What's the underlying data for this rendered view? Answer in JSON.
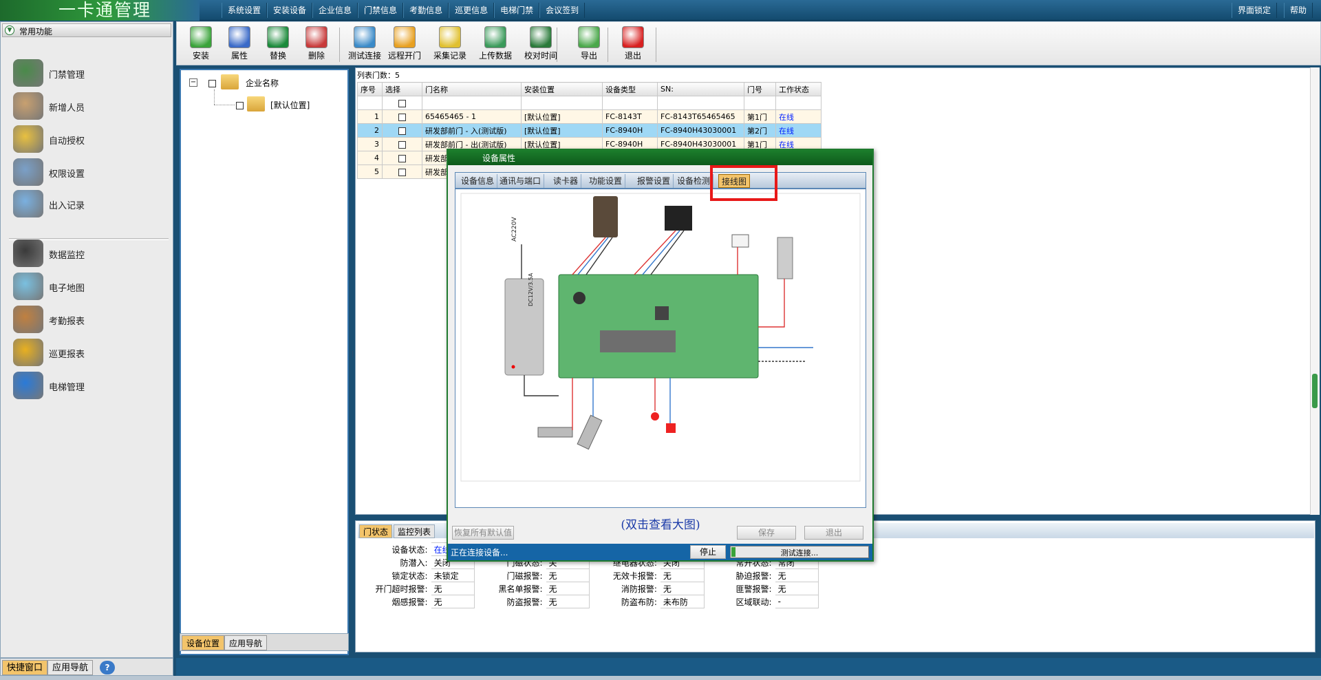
{
  "app": {
    "title": "一卡通管理"
  },
  "menu": [
    "系统设置",
    "安装设备",
    "企业信息",
    "门禁信息",
    "考勤信息",
    "巡更信息",
    "电梯门禁",
    "会议签到"
  ],
  "topright": {
    "lock": "界面锁定",
    "help": "帮助"
  },
  "sidebar": {
    "header": "常用功能",
    "items": [
      {
        "label": "门禁管理",
        "icon": "door-access-icon"
      },
      {
        "label": "新增人员",
        "icon": "person-icon"
      },
      {
        "label": "自动授权",
        "icon": "card-icon"
      },
      {
        "label": "权限设置",
        "icon": "permission-icon"
      },
      {
        "label": "出入记录",
        "icon": "magnifier-icon"
      },
      {
        "label": "数据监控",
        "icon": "camera-icon"
      },
      {
        "label": "电子地图",
        "icon": "map-icon"
      },
      {
        "label": "考勤报表",
        "icon": "clock-icon"
      },
      {
        "label": "巡更报表",
        "icon": "blocks-icon"
      },
      {
        "label": "电梯管理",
        "icon": "elevator-icon"
      }
    ]
  },
  "sidebar_tabs": {
    "quick": "快捷窗口",
    "nav": "应用导航"
  },
  "toolbar": [
    {
      "label": "安装",
      "icon": "install-icon",
      "color": "#3aa33a"
    },
    {
      "label": "属性",
      "icon": "properties-icon",
      "color": "#3a6ac8"
    },
    {
      "label": "替换",
      "icon": "replace-icon",
      "color": "#1a8a3a"
    },
    {
      "label": "删除",
      "icon": "delete-icon",
      "color": "#c83a3a"
    },
    {
      "label": "测试连接",
      "icon": "test-connect-icon",
      "color": "#3a8ac8"
    },
    {
      "label": "远程开门",
      "icon": "lock-open-icon",
      "color": "#e8a020"
    },
    {
      "label": "采集记录",
      "icon": "collect-icon",
      "color": "#e0c030"
    },
    {
      "label": "上传数据",
      "icon": "upload-icon",
      "color": "#3a9a5a"
    },
    {
      "label": "校对时间",
      "icon": "calendar-icon",
      "color": "#2a7a3a"
    },
    {
      "label": "导出",
      "icon": "export-icon",
      "color": "#4aa84a"
    },
    {
      "label": "退出",
      "icon": "power-icon",
      "color": "#d82020"
    }
  ],
  "tree": {
    "root": "企业名称",
    "child": "[默认位置]",
    "tabs": {
      "location": "设备位置",
      "nav": "应用导航"
    }
  },
  "list": {
    "count_label": "列表门数：5",
    "headers": [
      "序号",
      "选择",
      "门名称",
      "安装位置",
      "设备类型",
      "SN:",
      "门号",
      "工作状态"
    ],
    "rows": [
      [
        "1",
        "",
        "65465465 - 1",
        "[默认位置]",
        "FC-8143T",
        "FC-8143T65465465",
        "第1门",
        "在线"
      ],
      [
        "2",
        "",
        "研发部前门 - 入(测试版)",
        "[默认位置]",
        "FC-8940H",
        "FC-8940H43030001",
        "第2门",
        "在线"
      ],
      [
        "3",
        "",
        "研发部前门 - 出(测试版)",
        "[默认位置]",
        "FC-8940H",
        "FC-8940H43030001",
        "第1门",
        "在线"
      ],
      [
        "4",
        "",
        "研发部",
        "",
        "",
        "",
        "",
        ""
      ],
      [
        "5",
        "",
        "研发部",
        "",
        "",
        "",
        "",
        ""
      ]
    ]
  },
  "status": {
    "tabs": [
      "门状态",
      "监控列表"
    ],
    "fields": [
      [
        "设备状态:",
        "在线",
        "",
        "",
        "",
        "",
        "",
        ""
      ],
      [
        "防潜入:",
        "关闭",
        "门磁状态:",
        "关",
        "继电器状态:",
        "关闭",
        "常开状态:",
        "常闭"
      ],
      [
        "锁定状态:",
        "未锁定",
        "门磁报警:",
        "无",
        "无效卡报警:",
        "无",
        "胁迫报警:",
        "无"
      ],
      [
        "开门超时报警:",
        "无",
        "黑名单报警:",
        "无",
        "消防报警:",
        "无",
        "匪警报警:",
        "无"
      ],
      [
        "烟感报警:",
        "无",
        "防盗报警:",
        "无",
        "防盗布防:",
        "未布防",
        "区域联动:",
        "-"
      ]
    ]
  },
  "modal": {
    "title": "设备属性",
    "tabs": [
      "设备信息",
      "通讯与端口",
      "读卡器",
      "功能设置",
      "报警设置",
      "设备检测",
      "接线图"
    ],
    "active_tab": "接线图",
    "caption": "(双击查看大图)",
    "restore": "恢复所有默认值",
    "save": "保存",
    "exit": "退出",
    "status_text": "正在连接设备...",
    "stop": "停止",
    "progress_text": "测试连接...",
    "diagram": {
      "ac_label": "AC220V",
      "psu_label": "DC12V/3.5A"
    }
  },
  "colors": {
    "accent": "#1f7a2e",
    "highlight": "#e81818",
    "online": "#0020ff"
  }
}
